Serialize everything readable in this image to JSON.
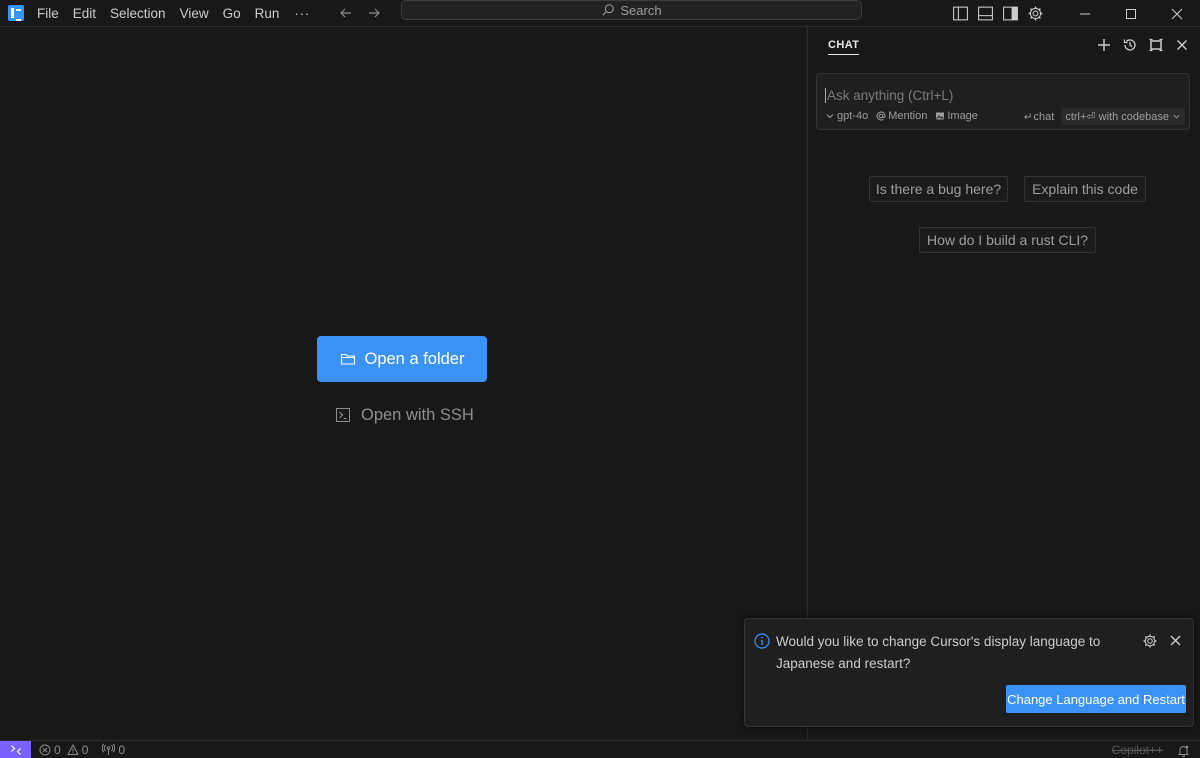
{
  "titlebar": {
    "menu": [
      "File",
      "Edit",
      "Selection",
      "View",
      "Go",
      "Run"
    ],
    "more": "···",
    "search_label": "Search"
  },
  "editor": {
    "open_folder_label": "Open a folder",
    "open_ssh_label": "Open with SSH"
  },
  "chat": {
    "title": "CHAT",
    "input_placeholder": "Ask anything (Ctrl+L)",
    "model": "gpt-4o",
    "mention_label": "Mention",
    "image_label": "Image",
    "chat_shortcut": "chat",
    "codebase_label": "ctrl+⏎ with codebase",
    "suggestions": [
      "Is there a bug here?",
      "Explain this code",
      "How do I build a rust CLI?"
    ]
  },
  "notification": {
    "message": "Would you like to change Cursor's display language to Japanese and restart?",
    "action_label": "Change Language and Restart"
  },
  "statusbar": {
    "errors": "0",
    "warnings": "0",
    "ports": "0",
    "copilot": "Copilot++"
  },
  "colors": {
    "background": "#181818",
    "accent": "#3a92f5",
    "remote": "#7b61ff"
  }
}
